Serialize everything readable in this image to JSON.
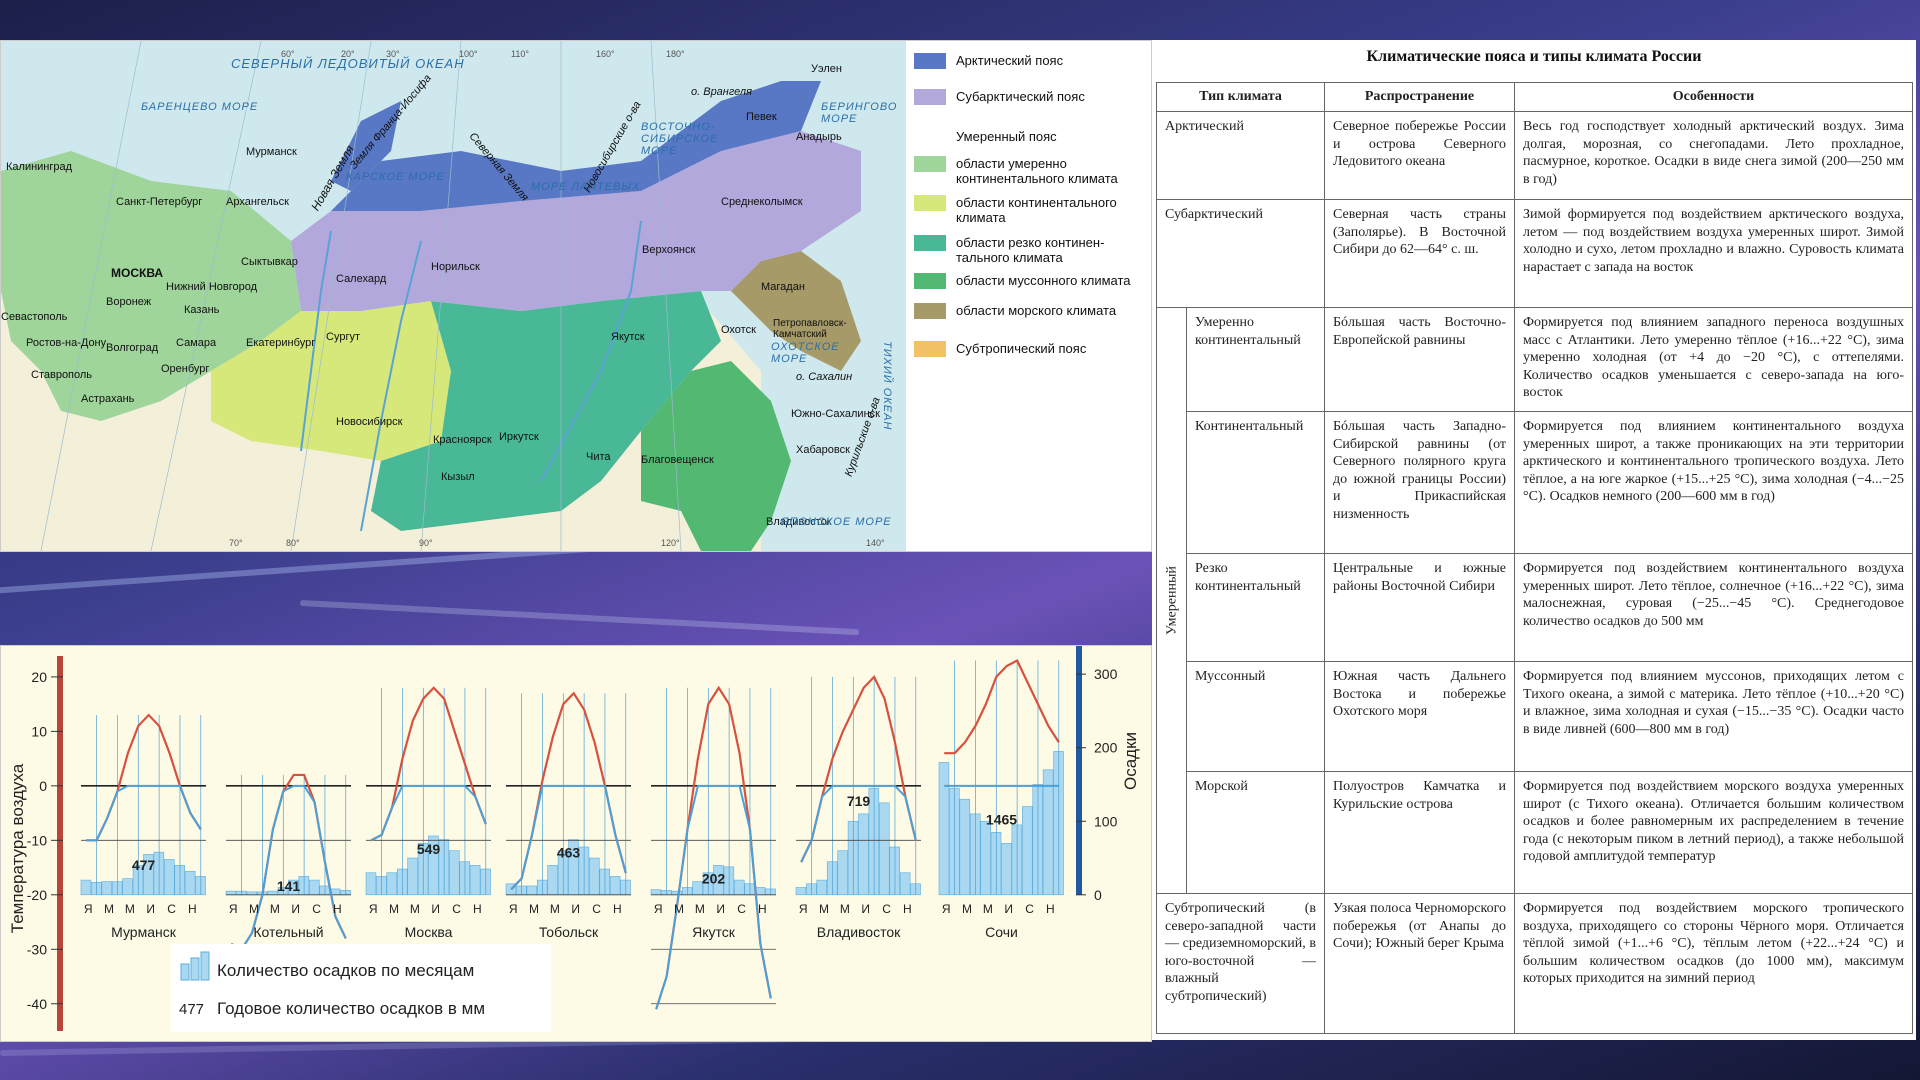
{
  "map": {
    "legend": [
      {
        "label": "Арктический пояс",
        "color": "#5877c4"
      },
      {
        "label": "Субарктический пояс",
        "color": "#b3a8dc"
      },
      {
        "label": "Умеренный пояс",
        "color": ""
      },
      {
        "label": "области умеренно континентального климата",
        "color": "#9fd49a"
      },
      {
        "label": "области континентального климата",
        "color": "#d7e87a"
      },
      {
        "label": "области резко континен-тального климата",
        "color": "#49b896"
      },
      {
        "label": "области муссонного климата",
        "color": "#52b872"
      },
      {
        "label": "области морского климата",
        "color": "#a69a68"
      },
      {
        "label": "Субтропический пояс",
        "color": "#f2c167"
      }
    ],
    "cities": [
      "Калининград",
      "Мурманск",
      "Санкт-Петербург",
      "Архангельск",
      "МОСКВА",
      "Нижний Новгород",
      "Сыктывкар",
      "Воронеж",
      "Казань",
      "Севастополь",
      "Волгоград",
      "Самара",
      "Ростов-на-Дону",
      "Ставрополь",
      "Оренбург",
      "Астрахань",
      "Екатеринбург",
      "Салехард",
      "Сургут",
      "Норильск",
      "Новосибирск",
      "Красноярск",
      "Кызыл",
      "Иркутск",
      "Чита",
      "Благовещенск",
      "Хабаровск",
      "Владивосток",
      "Южно-Сахалинск",
      "Якутск",
      "Верхоянск",
      "Магадан",
      "Охотск",
      "Петропавловск-Камчатский",
      "Среднеколымск",
      "Певек",
      "Анадырь",
      "Уэлен"
    ],
    "seas": [
      "БАРЕНЦЕВО МОРЕ",
      "КАРСКОЕ МОРЕ",
      "МОРЕ ЛАПТЕВЫХ",
      "ВОСТОЧНО-СИБИРСКОЕ МОРЕ",
      "БЕРИНГОВО МОРЕ",
      "ОХОТСКОЕ МОРЕ",
      "ЯПОНСКОЕ МОРЕ",
      "СЕВЕРНЫЙ ЛЕДОВИТЫЙ ОКЕАН",
      "ТИХИЙ ОКЕАН"
    ],
    "islands": [
      "Новая Земля",
      "Земля Франца-Иосифа",
      "Северная Земля",
      "Новосибирские о-ва",
      "о. Врангеля",
      "о. Сахалин",
      "Курильские о-ва"
    ],
    "longitudes": [
      "20°",
      "30°",
      "60°",
      "70°",
      "80°",
      "90°",
      "100°",
      "110°",
      "120°",
      "140°",
      "160°",
      "180°"
    ]
  },
  "chart": {
    "y_axis_label": "Температура воздуха",
    "y2_axis_label": "Осадки",
    "y2_unit": "мм",
    "temp_ticks": [
      20,
      10,
      0,
      -10,
      -20,
      -30,
      -40
    ],
    "precip_ticks": [
      300,
      200,
      100,
      0
    ],
    "month_labels": [
      "Я",
      "М",
      "М",
      "И",
      "С",
      "Н"
    ],
    "legend_bars": "Количество осадков по месяцам",
    "legend_num": "477",
    "legend_num_text": "Годовое количество осадков в мм"
  },
  "chart_data": {
    "type": "line",
    "note_series": "monthly air temperature curves and monthly precipitation bars per city",
    "stations": [
      {
        "name": "Мурманск",
        "annual_precip": "477",
        "temps": [
          -10,
          -10,
          -6,
          -1,
          6,
          11,
          13,
          11,
          6,
          0,
          -5,
          -8
        ],
        "precip": [
          20,
          17,
          18,
          18,
          22,
          40,
          55,
          58,
          48,
          40,
          32,
          25
        ]
      },
      {
        "name": "Котельный",
        "annual_precip": "141",
        "temps": [
          -29,
          -30,
          -27,
          -20,
          -8,
          -1,
          2,
          2,
          -3,
          -14,
          -24,
          -28
        ],
        "precip": [
          5,
          5,
          4,
          4,
          5,
          10,
          20,
          25,
          20,
          12,
          8,
          6
        ]
      },
      {
        "name": "Москва",
        "annual_precip": "549",
        "temps": [
          -10,
          -9,
          -4,
          5,
          12,
          16,
          18,
          16,
          10,
          4,
          -2,
          -7
        ],
        "precip": [
          30,
          25,
          30,
          35,
          50,
          70,
          80,
          75,
          60,
          45,
          40,
          35
        ]
      },
      {
        "name": "Тобольск",
        "annual_precip": "463",
        "temps": [
          -19,
          -17,
          -9,
          1,
          9,
          15,
          17,
          14,
          8,
          0,
          -9,
          -16
        ],
        "precip": [
          15,
          12,
          12,
          20,
          40,
          60,
          75,
          65,
          50,
          35,
          25,
          20
        ]
      },
      {
        "name": "Якутск",
        "annual_precip": "202",
        "temps": [
          -41,
          -35,
          -22,
          -8,
          5,
          15,
          18,
          15,
          6,
          -8,
          -29,
          -39
        ],
        "precip": [
          7,
          6,
          5,
          10,
          18,
          30,
          40,
          38,
          20,
          15,
          10,
          8
        ]
      },
      {
        "name": "Владивосток",
        "annual_precip": "719",
        "temps": [
          -14,
          -10,
          -2,
          5,
          10,
          14,
          18,
          20,
          16,
          8,
          -2,
          -10
        ],
        "precip": [
          10,
          15,
          20,
          45,
          60,
          100,
          110,
          145,
          125,
          65,
          30,
          15
        ]
      },
      {
        "name": "Сочи",
        "annual_precip": "1465",
        "temps": [
          6,
          6,
          8,
          11,
          15,
          20,
          22,
          23,
          19,
          15,
          11,
          8
        ],
        "precip": [
          180,
          145,
          130,
          110,
          100,
          85,
          70,
          95,
          120,
          150,
          170,
          195
        ]
      }
    ],
    "temp_ylim": [
      -45,
      22
    ],
    "precip_ylim": [
      0,
      400
    ]
  },
  "table": {
    "title": "Климатические пояса и типы климата России",
    "headers": [
      "Тип климата",
      "Распространение",
      "Особенности"
    ],
    "group_label": "Умеренный",
    "rows": [
      {
        "type": "Арктический",
        "spread": "Северное побережье России и острова Северного Ледовитого океана",
        "features": "Весь год господствует холодный арктический воздух. Зима долгая, морозная, со снегопадами. Лето прохладное, пасмурное, короткое. Осадки в виде снега зимой (200—250 мм в год)"
      },
      {
        "type": "Субарктический",
        "spread": "Северная часть страны (Заполярье). В Восточной Сибири до 62—64° с. ш.",
        "features": "Зимой формируется под воздействием арктического воздуха, летом — под воздействием воздуха умеренных широт. Зимой холодно и сухо, летом прохладно и влажно. Суровость климата нарастает с запада на восток"
      },
      {
        "type": "Умеренно континентальный",
        "spread": "Бóльшая часть Восточно-Европейской равнины",
        "features": "Формируется под влиянием западного переноса воздушных масс с Атлантики. Лето умеренно тёплое (+16...+22 °С), зима умеренно холодная (от +4 до −20 °С), с оттепелями. Количество осадков уменьшается с северо-запада на юго-восток"
      },
      {
        "type": "Континентальный",
        "spread": "Бóльшая часть Западно-Сибирской равнины (от Северного полярного круга до южной границы России) и Прикаспийская низменность",
        "features": "Формируется под влиянием континентального воздуха умеренных широт, а также проникающих на эти территории арктического и континентального тропического воздуха. Лето тёплое, а на юге жаркое (+15...+25 °С), зима холодная (−4...−25 °С). Осадков немного (200—600 мм в год)"
      },
      {
        "type": "Резко континентальный",
        "spread": "Центральные и южные районы Восточной Сибири",
        "features": "Формируется под воздействием континентального воздуха умеренных широт. Лето тёплое, солнечное (+16...+22 °С), зима малоснежная, суровая (−25...−45 °С). Среднегодовое количество осадков до 500 мм"
      },
      {
        "type": "Муссонный",
        "spread": "Южная часть Дальнего Востока и побережье Охотского моря",
        "features": "Формируется под влиянием муссонов, приходящих летом с Тихого океана, а зимой с материка. Лето тёплое (+10...+20 °С) и влажное, зима холодная и сухая (−15...−35 °С). Осадки часто в виде ливней (600—800 мм в год)"
      },
      {
        "type": "Морской",
        "spread": "Полуостров Камчатка и Курильские острова",
        "features": "Формируется под воздействием морского воздуха умеренных широт (с Тихого океана). Отличается большим количеством осадков и более равномерным их распределением в течение года (с некоторым пиком в летний период), а также небольшой годовой амплитудой температур"
      },
      {
        "type": "Субтропический (в северо-западной части — средиземноморский, в юго-восточной — влажный субтропический)",
        "spread": "Узкая полоса Черноморского побережья (от Анапы до Сочи); Южный берег Крыма",
        "features": "Формируется под воздействием морского тропического воздуха, приходящего со стороны Чёрного моря. Отличается тёплой зимой (+1...+6 °С), тёплым летом (+22...+24 °С) и большим количеством осадков (до 1000 мм), максимум которых приходится на зимний период"
      }
    ]
  }
}
